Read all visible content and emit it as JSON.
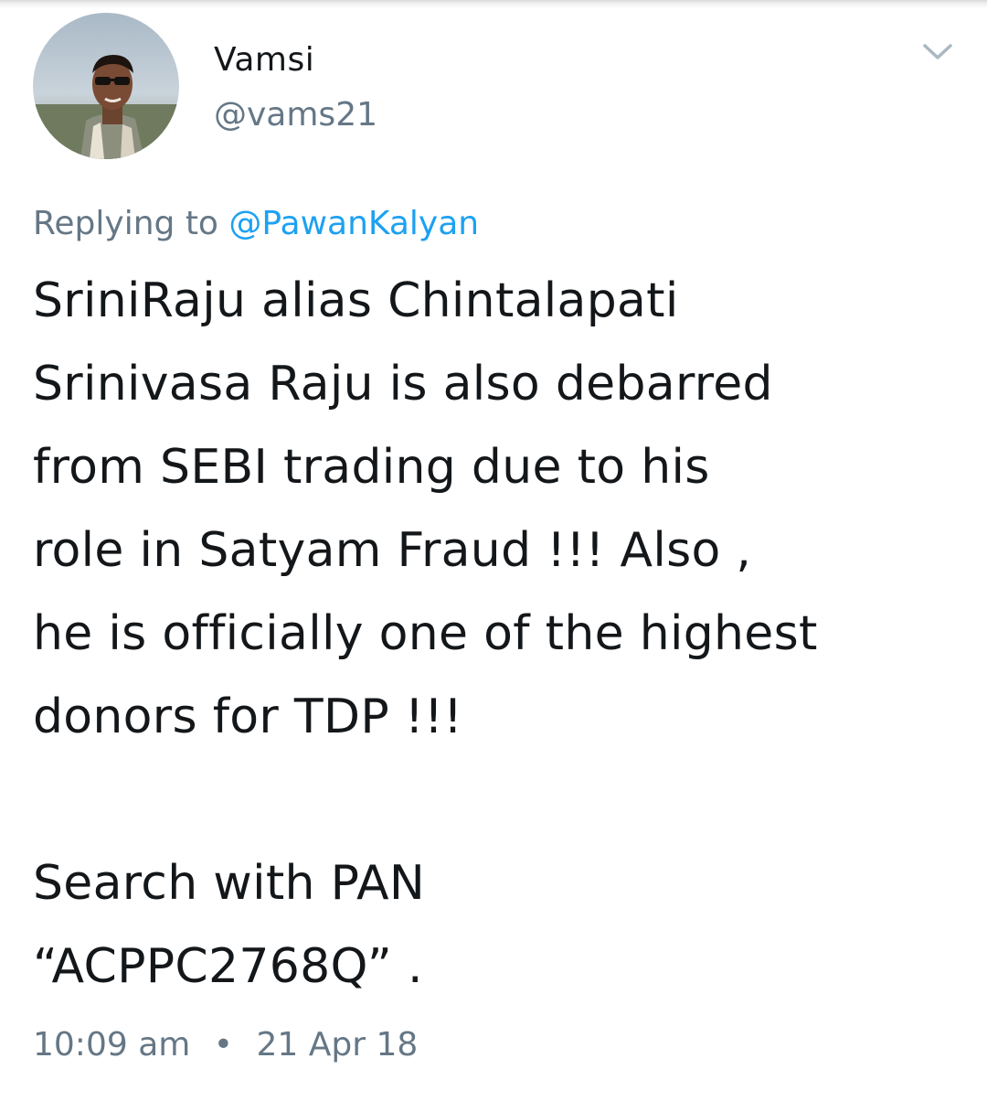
{
  "tweet": {
    "user": {
      "display_name": "Vamsi",
      "handle": "@vams21"
    },
    "replying_prefix": "Replying to",
    "replying_to": "@PawanKalyan",
    "body": "SriniRaju alias Chintalapati\nSrinivasa Raju is also debarred\nfrom SEBI trading due to his\nrole in Satyam Fraud !!! Also ,\nhe is officially one of the highest\ndonors for TDP !!!\n\nSearch with PAN\n“ACPPC2768Q” .",
    "time": "10:09 am",
    "separator": "•",
    "date": "21 Apr 18"
  },
  "icons": {
    "menu": "chevron-down-icon"
  },
  "colors": {
    "text_primary": "#14171a",
    "text_secondary": "#657786",
    "mention": "#1da1f2"
  }
}
